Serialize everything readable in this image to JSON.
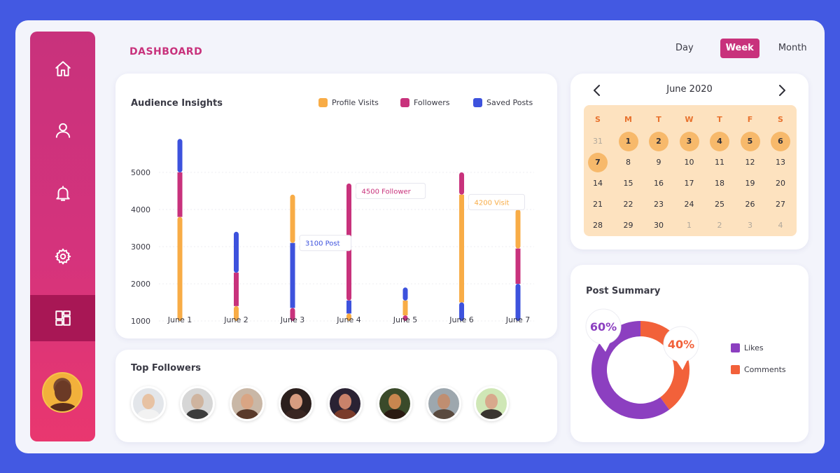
{
  "header": {
    "title": "DASHBOARD"
  },
  "period_tabs": [
    {
      "label": "Day",
      "active": false
    },
    {
      "label": "Week",
      "active": true
    },
    {
      "label": "Month",
      "active": false
    }
  ],
  "sidebar": {
    "items": [
      {
        "icon": "home-icon"
      },
      {
        "icon": "user-icon"
      },
      {
        "icon": "bell-icon"
      },
      {
        "icon": "gear-icon"
      },
      {
        "icon": "dashboard-grid-icon",
        "active": true
      }
    ]
  },
  "audience_insights": {
    "title": "Audience Insights",
    "legend": [
      {
        "label": "Profile Visits",
        "color": "#f8ac46"
      },
      {
        "label": "Followers",
        "color": "#c8327c"
      },
      {
        "label": "Saved Posts",
        "color": "#3d52dd"
      }
    ],
    "tooltips": [
      {
        "text": "3100 Post",
        "color": "#3d52dd",
        "category": "June 3"
      },
      {
        "text": "4500 Follower",
        "color": "#c8327c",
        "category": "June 4"
      },
      {
        "text": "4200 Visit",
        "color": "#f8ac46",
        "category": "June 6"
      }
    ]
  },
  "chart_data": {
    "type": "bar",
    "stacked": true,
    "title": "Audience Insights",
    "categories": [
      "June 1",
      "June 2",
      "June 3",
      "June 4",
      "June 5",
      "June 6",
      "June 7"
    ],
    "yticks": [
      1000,
      2000,
      3000,
      4000,
      5000
    ],
    "ylim": [
      1000,
      5000
    ],
    "segments": [
      [
        {
          "series": "Profile Visits",
          "from": 1000,
          "to": 3800
        },
        {
          "series": "Followers",
          "from": 3800,
          "to": 5000
        },
        {
          "series": "Saved Posts",
          "from": 5000,
          "to": 5900
        }
      ],
      [
        {
          "series": "Profile Visits",
          "from": 1000,
          "to": 1400
        },
        {
          "series": "Followers",
          "from": 1400,
          "to": 2300
        },
        {
          "series": "Saved Posts",
          "from": 2300,
          "to": 3400
        }
      ],
      [
        {
          "series": "Followers",
          "from": 1000,
          "to": 1350
        },
        {
          "series": "Saved Posts",
          "from": 1350,
          "to": 3100
        },
        {
          "series": "Profile Visits",
          "from": 3100,
          "to": 4400
        }
      ],
      [
        {
          "series": "Profile Visits",
          "from": 1000,
          "to": 1200
        },
        {
          "series": "Saved Posts",
          "from": 1200,
          "to": 1550
        },
        {
          "series": "Followers",
          "from": 1550,
          "to": 4700
        }
      ],
      [
        {
          "series": "Followers",
          "from": 1000,
          "to": 1150
        },
        {
          "series": "Profile Visits",
          "from": 1150,
          "to": 1550
        },
        {
          "series": "Saved Posts",
          "from": 1550,
          "to": 1900
        }
      ],
      [
        {
          "series": "Saved Posts",
          "from": 1000,
          "to": 1500
        },
        {
          "series": "Profile Visits",
          "from": 1500,
          "to": 4400
        },
        {
          "series": "Followers",
          "from": 4400,
          "to": 5000
        }
      ],
      [
        {
          "series": "Saved Posts",
          "from": 1000,
          "to": 2000
        },
        {
          "series": "Followers",
          "from": 2000,
          "to": 2950
        },
        {
          "series": "Profile Visits",
          "from": 2950,
          "to": 4000
        }
      ]
    ]
  },
  "top_followers": {
    "title": "Top Followers",
    "followers": [
      {
        "avatar": "follower-avatar-1"
      },
      {
        "avatar": "follower-avatar-2"
      },
      {
        "avatar": "follower-avatar-3"
      },
      {
        "avatar": "follower-avatar-4"
      },
      {
        "avatar": "follower-avatar-5"
      },
      {
        "avatar": "follower-avatar-6"
      },
      {
        "avatar": "follower-avatar-7"
      },
      {
        "avatar": "follower-avatar-8"
      }
    ]
  },
  "calendar": {
    "month": "June 2020",
    "weekdays": [
      "S",
      "M",
      "T",
      "W",
      "T",
      "F",
      "S"
    ],
    "weeks": [
      [
        {
          "d": "31",
          "muted": true
        },
        {
          "d": "1",
          "hl": true
        },
        {
          "d": "2",
          "hl": true
        },
        {
          "d": "3",
          "hl": true
        },
        {
          "d": "4",
          "hl": true
        },
        {
          "d": "5",
          "hl": true
        },
        {
          "d": "6",
          "hl": true
        }
      ],
      [
        {
          "d": "7",
          "hl": true
        },
        {
          "d": "8"
        },
        {
          "d": "9"
        },
        {
          "d": "10"
        },
        {
          "d": "11"
        },
        {
          "d": "12"
        },
        {
          "d": "13"
        }
      ],
      [
        {
          "d": "14"
        },
        {
          "d": "15"
        },
        {
          "d": "16"
        },
        {
          "d": "17"
        },
        {
          "d": "18"
        },
        {
          "d": "19"
        },
        {
          "d": "20"
        }
      ],
      [
        {
          "d": "21"
        },
        {
          "d": "22"
        },
        {
          "d": "23"
        },
        {
          "d": "24"
        },
        {
          "d": "25"
        },
        {
          "d": "26"
        },
        {
          "d": "27"
        }
      ],
      [
        {
          "d": "28"
        },
        {
          "d": "29"
        },
        {
          "d": "30"
        },
        {
          "d": "1",
          "muted": true
        },
        {
          "d": "2",
          "muted": true
        },
        {
          "d": "3",
          "muted": true
        },
        {
          "d": "4",
          "muted": true
        }
      ]
    ]
  },
  "post_summary": {
    "title": "Post Summary",
    "likes_pct": 60,
    "comments_pct": 40,
    "likes_label": "60%",
    "comments_label": "40%",
    "legend": [
      {
        "label": "Likes",
        "color": "#8c3fc0"
      },
      {
        "label": "Comments",
        "color": "#f2613a"
      }
    ]
  },
  "colors": {
    "primary": "#c8327c",
    "background": "#4359e2",
    "profile_visits": "#f8ac46",
    "followers": "#c8327c",
    "saved_posts": "#3d52dd"
  }
}
